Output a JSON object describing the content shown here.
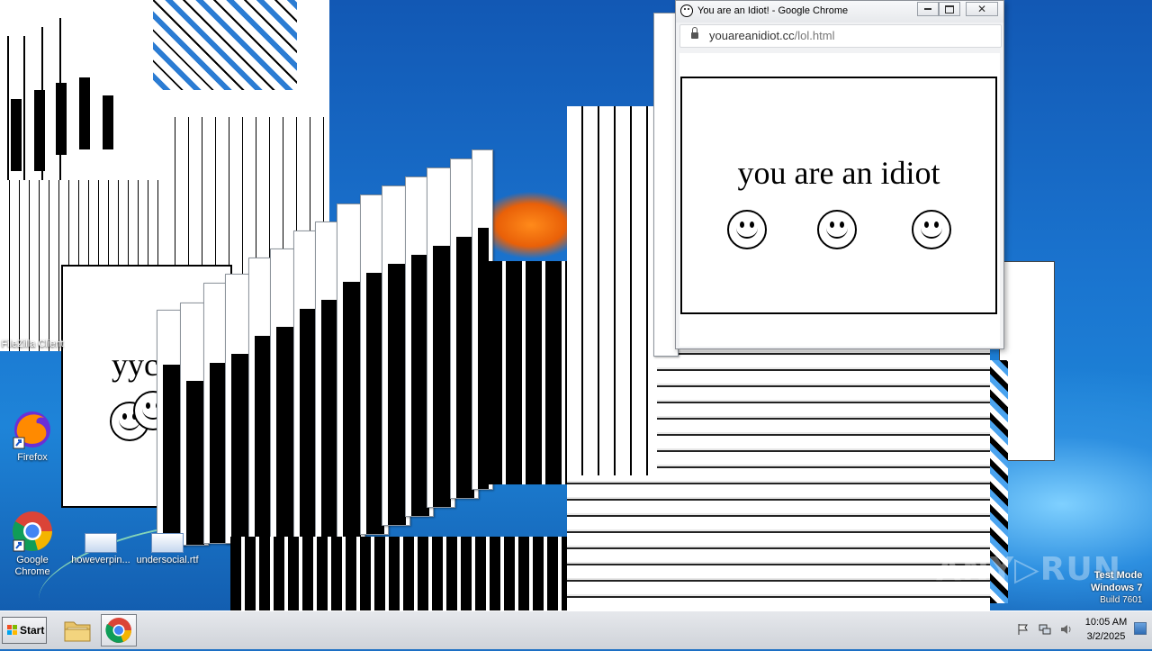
{
  "main_window": {
    "title": "You are an Idiot! - Google Chrome",
    "url_host": "youareanidiot.cc",
    "url_path": "/lol.html",
    "message": "you are an idiot",
    "smileys": [
      "smiley-1",
      "smiley-2",
      "smiley-3"
    ]
  },
  "left_window": {
    "message_fragment": "yyc"
  },
  "desktop_icons": [
    {
      "label": "FileZilla Client",
      "icon": "filezilla-icon"
    },
    {
      "label": "Firefox",
      "icon": "firefox-icon"
    },
    {
      "label": "Google Chrome",
      "icon": "chrome-icon"
    },
    {
      "label": "howeverpin...",
      "icon": "document-icon"
    },
    {
      "label": "undersocial.rtf",
      "icon": "rtf-document-icon"
    }
  ],
  "taskbar": {
    "start_label": "Start",
    "apps": [
      "windows-explorer",
      "google-chrome"
    ],
    "clock_time": "10:05 AM",
    "clock_date": "3/2/2025"
  },
  "watermark": {
    "line1": "Test Mode",
    "line2": "Windows 7",
    "line3": "Build 7601",
    "brand": "ANY RUN"
  },
  "colors": {
    "desktop_blue": "#1c6fc4",
    "taskbar_gray": "#d6d9de",
    "popup_black": "#000000"
  }
}
